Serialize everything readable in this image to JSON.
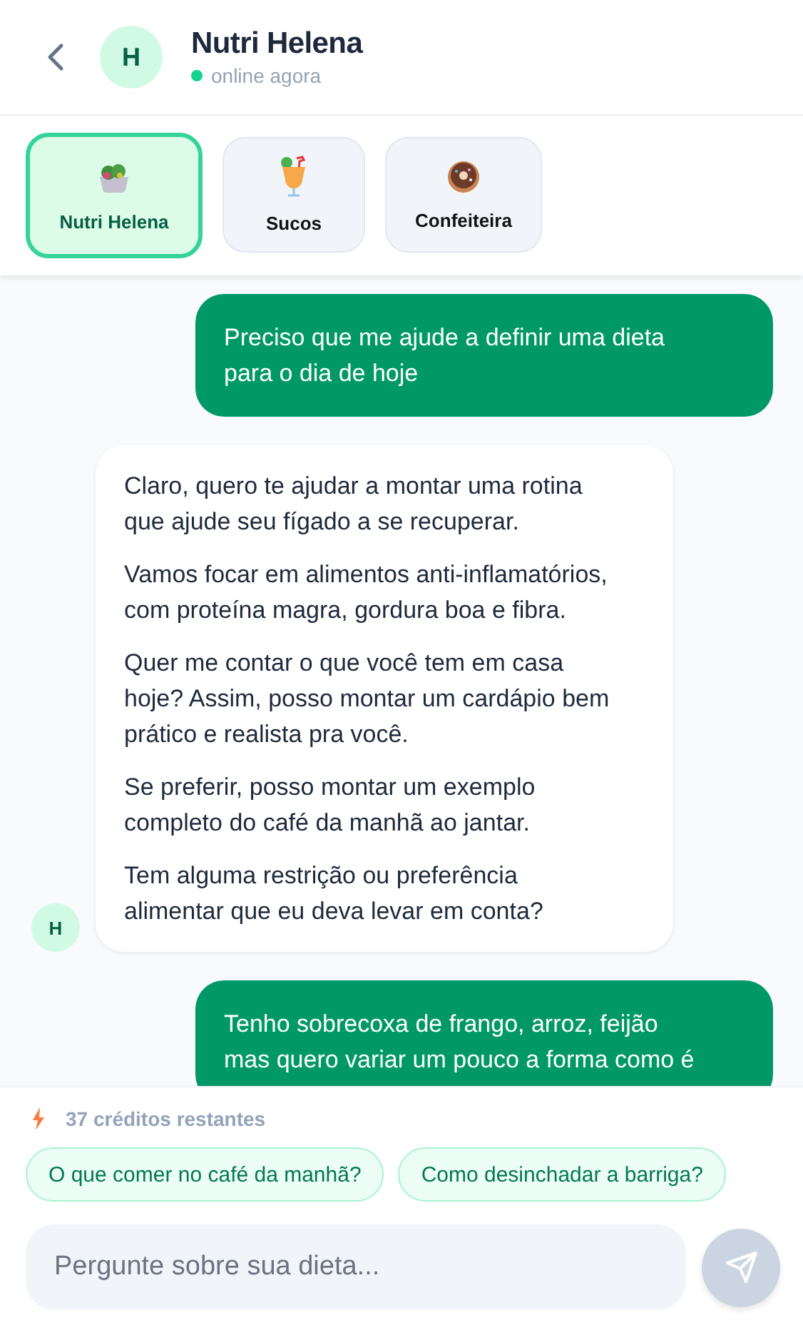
{
  "header": {
    "avatar": "H",
    "name": "Nutri Helena",
    "status": "online agora",
    "online": true
  },
  "assistants": [
    {
      "label": "Nutri Helena",
      "kind": "salad",
      "selected": true
    },
    {
      "label": "Sucos",
      "kind": "juice",
      "selected": false
    },
    {
      "label": "Confeiteira",
      "kind": "donut",
      "selected": false
    }
  ],
  "messages": [
    {
      "kind": "user",
      "paragraphs": [
        "Preciso que me ajude a definir uma dieta para o dia de hoje"
      ]
    },
    {
      "kind": "assistant",
      "avatar": "H",
      "paragraphs": [
        "Claro, quero te ajudar a montar uma rotina que ajude seu fígado a se recuperar.",
        "Vamos focar em alimentos anti-inflamatórios, com proteína magra, gordura boa e fibra.",
        "Quer me contar o que você tem em casa hoje? Assim, posso montar um cardápio bem prático e realista pra você.",
        "Se preferir, posso montar um exemplo completo do café da manhã ao jantar.",
        "Tem alguma restrição ou preferência alimentar que eu deva levar em conta?"
      ]
    },
    {
      "kind": "user",
      "paragraphs": [
        "Tenho sobrecoxa de frango, arroz, feijão mas quero variar um pouco a forma como é"
      ]
    }
  ],
  "credits": "37 créditos restantes",
  "suggestions": [
    "O que comer no café da manhã?",
    "Como desinchadar a barriga?"
  ],
  "composer": {
    "placeholder": "Pergunte sobre sua dieta...",
    "disabled": true
  }
}
